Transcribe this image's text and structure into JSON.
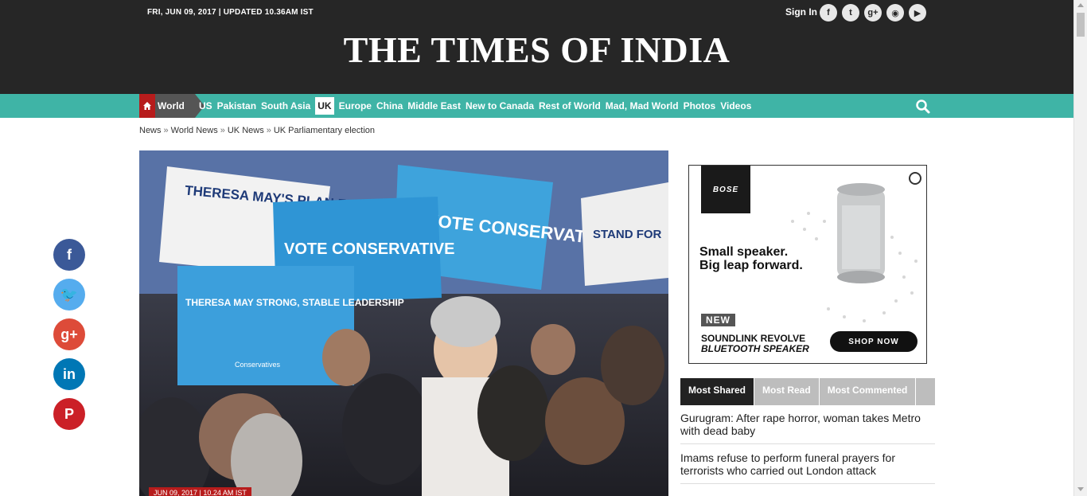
{
  "header": {
    "dateline": "FRI, JUN 09, 2017 | UPDATED 10.36AM IST",
    "signin_label": "Sign In",
    "social_icons": [
      {
        "name": "facebook-icon",
        "glyph": "f"
      },
      {
        "name": "twitter-icon",
        "glyph": "t"
      },
      {
        "name": "googleplus-icon",
        "glyph": "g+"
      },
      {
        "name": "rss-icon",
        "glyph": "◉"
      },
      {
        "name": "youtube-icon",
        "glyph": "▶"
      }
    ],
    "masthead": "THE TIMES OF INDIA"
  },
  "nav": {
    "section": "World",
    "items": [
      "US",
      "Pakistan",
      "South Asia",
      "UK",
      "Europe",
      "China",
      "Middle East",
      "New to Canada",
      "Rest of World",
      "Mad, Mad World",
      "Photos",
      "Videos"
    ],
    "active_item": "UK",
    "accent": "#3fb4a6"
  },
  "breadcrumb": {
    "items": [
      "News",
      "World News",
      "UK News",
      "UK Parliamentary election"
    ],
    "separator": "»"
  },
  "hero": {
    "signs": [
      "THERESA MAY'S PLAN FOR A STRONGER BRITAIN",
      "VOTE CONSERVATIVE",
      "VOTE CONSERVATIVE",
      "THERESA MAY STRONG, STABLE LEADERSHIP",
      "STAND FOR",
      "Conservatives"
    ],
    "caption": "JUN 09, 2017 | 10.24 AM IST"
  },
  "share": [
    {
      "name": "facebook-share-icon",
      "glyph": "f",
      "color": "#3b5998"
    },
    {
      "name": "twitter-share-icon",
      "glyph": "🐦",
      "color": "#55acee"
    },
    {
      "name": "googleplus-share-icon",
      "glyph": "g+",
      "color": "#dd4b39"
    },
    {
      "name": "linkedin-share-icon",
      "glyph": "in",
      "color": "#0077b5"
    },
    {
      "name": "pinterest-share-icon",
      "glyph": "P",
      "color": "#cb2027"
    }
  ],
  "ad": {
    "brand": "BOSE",
    "headline_1": "Small speaker.",
    "headline_2": "Big leap forward.",
    "badge": "NEW",
    "product_1": "SOUNDLINK REVOLVE",
    "product_2": "BLUETOOTH SPEAKER",
    "cta": "SHOP NOW"
  },
  "tabs": [
    "Most Shared",
    "Most Read",
    "Most Commented"
  ],
  "stories": [
    "Gurugram: After rape horror, woman takes Metro with dead baby",
    "Imams refuse to perform funeral prayers for terrorists who carried out London attack"
  ]
}
